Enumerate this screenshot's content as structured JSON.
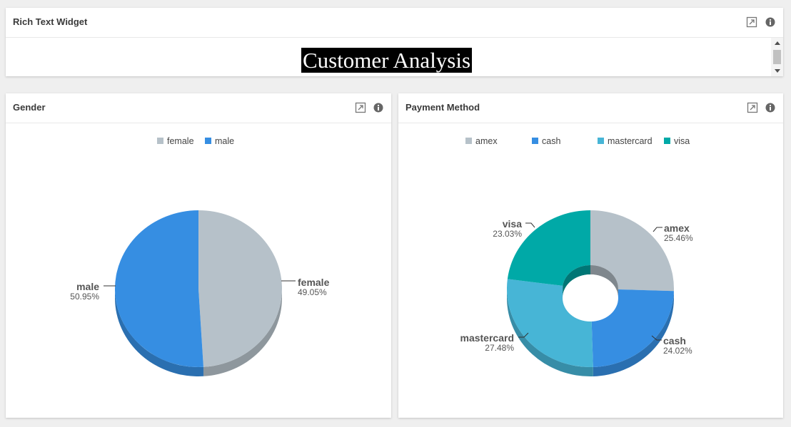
{
  "rich_text_widget": {
    "title": "Rich Text Widget",
    "heading": "Customer Analysis"
  },
  "icons": {
    "expand": "expand-icon",
    "info": "info-icon"
  },
  "gender_widget": {
    "title": "Gender",
    "chart_data": {
      "type": "pie",
      "title": "",
      "slices": [
        {
          "name": "female",
          "value": 49.05,
          "label": "49.05%",
          "color": "#b6c1c9"
        },
        {
          "name": "male",
          "value": 50.95,
          "label": "50.95%",
          "color": "#368ee2"
        }
      ],
      "legend": "top-center"
    }
  },
  "payment_widget": {
    "title": "Payment Method",
    "chart_data": {
      "type": "pie",
      "title": "",
      "donut": true,
      "slices": [
        {
          "name": "amex",
          "value": 25.46,
          "label": "25.46%",
          "color": "#b6c1c9"
        },
        {
          "name": "cash",
          "value": 24.02,
          "label": "24.02%",
          "color": "#368ee2"
        },
        {
          "name": "mastercard",
          "value": 27.48,
          "label": "27.48%",
          "color": "#47b5d6"
        },
        {
          "name": "visa",
          "value": 23.03,
          "label": "23.03%",
          "color": "#00a9a7"
        }
      ],
      "legend": "top-center"
    }
  }
}
